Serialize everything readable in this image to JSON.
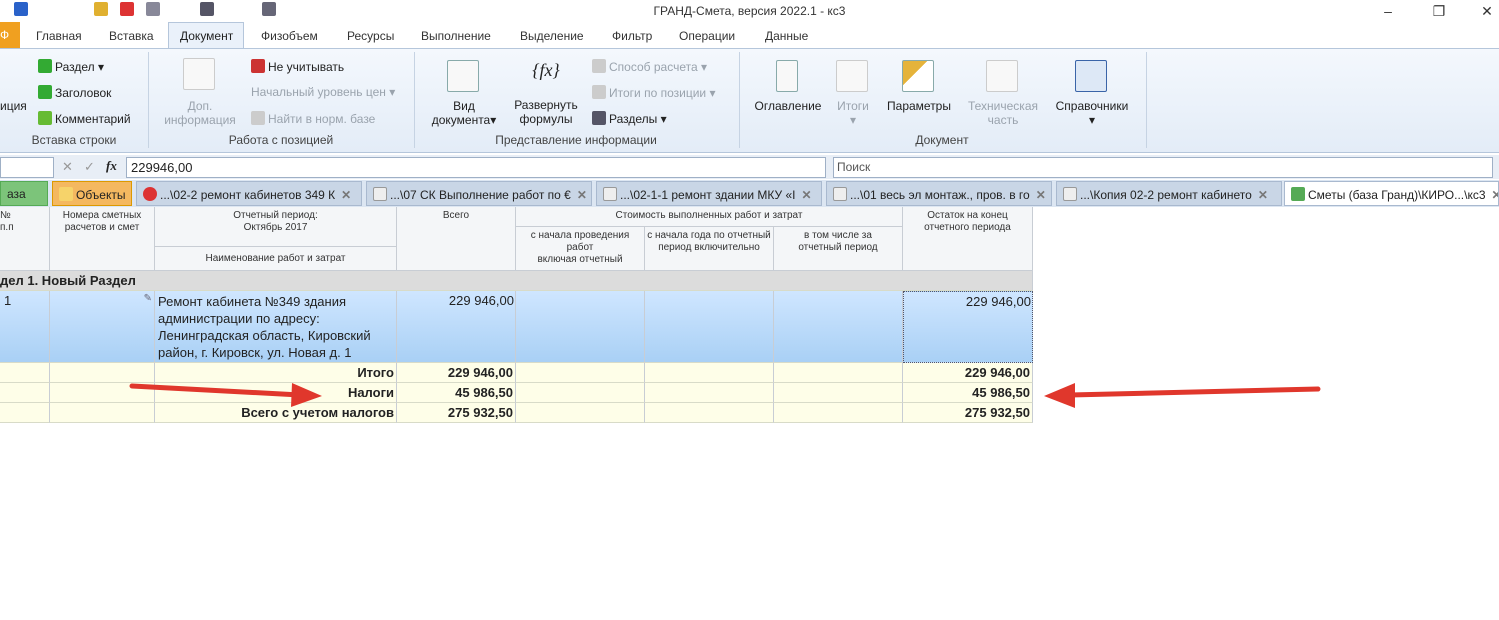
{
  "window": {
    "title": "ГРАНД-Смета, версия 2022.1 - кс3",
    "minimize": "–",
    "restore": "❐",
    "close": "✕"
  },
  "ribbon_tabs": [
    "Ф",
    "Главная",
    "Вставка",
    "Документ",
    "Физобъем",
    "Ресурсы",
    "Выполнение",
    "Выделение",
    "Фильтр",
    "Операции",
    "Данные"
  ],
  "ribbon": {
    "insert_row": {
      "partial_label": "иция",
      "section": "Раздел",
      "header": "Заголовок",
      "comment": "Комментарий",
      "group": "Вставка строки"
    },
    "position": {
      "extra_info_1": "Доп.",
      "extra_info_2": "информация",
      "ignore": "Не учитывать",
      "price_level": "Начальный уровень цен",
      "find_norm": "Найти в норм. базе",
      "group": "Работа с позицией"
    },
    "view": {
      "doc_view_1": "Вид",
      "doc_view_2": "документа",
      "expand_1": "Развернуть",
      "expand_2": "формулы",
      "calc_method": "Способ расчета",
      "pos_totals": "Итоги по позиции",
      "sections": "Разделы",
      "group": "Представление информации"
    },
    "document": {
      "toc": "Оглавление",
      "totals": "Итоги",
      "params": "Параметры",
      "tech_1": "Техническая",
      "tech_2": "часть",
      "refs": "Справочники",
      "group": "Документ"
    }
  },
  "formula_bar": {
    "value": "229946,00",
    "fx": "fx",
    "cancel": "✕",
    "accept": "✓",
    "search_placeholder": "Поиск"
  },
  "doc_tabs": [
    {
      "label": "аза"
    },
    {
      "label": "Объекты"
    },
    {
      "label": "...\\02-2 ремонт  кабинетов 349 К"
    },
    {
      "label": "...\\07 СК Выполнение работ по €"
    },
    {
      "label": "...\\02-1-1 ремонт здании МКУ «Ӏ"
    },
    {
      "label": "...\\01 весь эл монтаж., пров. в го"
    },
    {
      "label": "...\\Копия 02-2 ремонт  кабинето"
    },
    {
      "label": "Сметы (база Гранд)\\КИРО...\\кс3"
    }
  ],
  "table": {
    "headers": {
      "num": "№\nп.п",
      "calc_numbers": "Номера сметных расчетов и смет",
      "period": "Отчетный период:\nОктябрь 2017",
      "name": "Наименование работ и затрат",
      "total": "Всего",
      "cost_group": "Стоимость выполненных работ и затрат",
      "since_start": "с начала проведения работ\nвключая отчетный",
      "since_year": "с начала года по отчетный\nпериод включительно",
      "in_period": "в том числе за\nотчетный период",
      "remainder": "Остаток на конец отчетного периода"
    },
    "section": "дел 1. Новый Раздел",
    "row": {
      "num": "1",
      "name": "Ремонт кабинета №349 здания администрации по адресу: Ленинградская область, Кировский район, г. Кировск, ул. Новая д. 1",
      "total": "229 946,00",
      "remainder": "229 946,00"
    },
    "totals": [
      {
        "label": "Итого",
        "total": "229 946,00",
        "remainder": "229 946,00"
      },
      {
        "label": "Налоги",
        "total": "45 986,50",
        "remainder": "45 986,50"
      },
      {
        "label": "Всего с учетом налогов",
        "total": "275 932,50",
        "remainder": "275 932,50"
      }
    ]
  },
  "colors": {
    "arrow": "#e0372c",
    "selection": "#b8dafa",
    "totals_bg": "#fefee8"
  }
}
